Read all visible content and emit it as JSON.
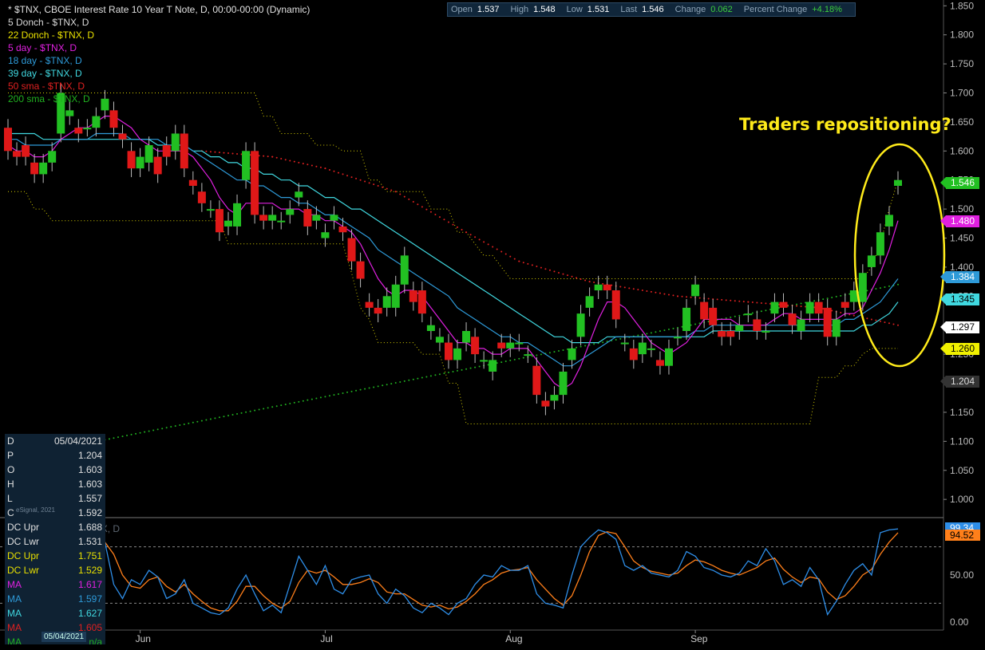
{
  "chart_data": {
    "type": "candlestick",
    "title": "* $TNX, CBOE Interest Rate 10 Year T Note, D, 00:00-00:00 (Dynamic)",
    "legend": [
      {
        "label": "5 Donch - $TNX, D",
        "color": "#d8d8d8"
      },
      {
        "label": "22 Donch - $TNX, D",
        "color": "#e8e000"
      },
      {
        "label": "5 day - $TNX, D",
        "color": "#e020e0"
      },
      {
        "label": "18 day - $TNX, D",
        "color": "#2e9ad8"
      },
      {
        "label": "39 day - $TNX, D",
        "color": "#40d8e0"
      },
      {
        "label": "50 sma - $TNX, D",
        "color": "#e02020"
      },
      {
        "label": "200 sma - $TNX, D",
        "color": "#20b020"
      }
    ],
    "quote": [
      {
        "label": "Open",
        "value": "1.537"
      },
      {
        "label": "High",
        "value": "1.548"
      },
      {
        "label": "Low",
        "value": "1.531"
      },
      {
        "label": "Last",
        "value": "1.546"
      },
      {
        "label": "Change",
        "value": "0.062"
      },
      {
        "label": "Percent Change",
        "value": "+4.18%"
      }
    ],
    "annotation": "Traders repositioning?",
    "y_axis": {
      "min": 0.97,
      "max": 1.86,
      "ticks": [
        "1.850",
        "1.800",
        "1.750",
        "1.700",
        "1.650",
        "1.600",
        "1.550",
        "1.500",
        "1.450",
        "1.400",
        "1.350",
        "1.300",
        "1.250",
        "1.200",
        "1.150",
        "1.100",
        "1.050",
        "1.000"
      ]
    },
    "x_axis": {
      "labels": [
        {
          "label": "Jun",
          "index": 15
        },
        {
          "label": "Jul",
          "index": 36
        },
        {
          "label": "Aug",
          "index": 57
        },
        {
          "label": "Sep",
          "index": 78
        }
      ]
    },
    "price_tags": [
      {
        "value": "1.546",
        "bg": "#22c022",
        "fg": "#fff",
        "price": 1.546
      },
      {
        "value": "1.480",
        "bg": "#e020e0",
        "fg": "#fff",
        "price": 1.48
      },
      {
        "value": "1.384",
        "bg": "#2e9ad8",
        "fg": "#fff",
        "price": 1.384
      },
      {
        "value": "1.345",
        "bg": "#40d8e0",
        "fg": "#000",
        "price": 1.345
      },
      {
        "value": "1.297",
        "bg": "#ffffff",
        "fg": "#000",
        "price": 1.297
      },
      {
        "value": "1.260",
        "bg": "#f0f000",
        "fg": "#000",
        "price": 1.26
      },
      {
        "value": "1.204",
        "bg": "#333333",
        "fg": "#ddd",
        "price": 1.204
      }
    ],
    "candles": [
      [
        1.64,
        1.6
      ],
      [
        1.6,
        1.59
      ],
      [
        1.61,
        1.59
      ],
      [
        1.58,
        1.56
      ],
      [
        1.56,
        1.58
      ],
      [
        1.58,
        1.6
      ],
      [
        1.63,
        1.7
      ],
      [
        1.66,
        1.67
      ],
      [
        1.64,
        1.63
      ],
      [
        1.64,
        1.64
      ],
      [
        1.64,
        1.66
      ],
      [
        1.67,
        1.69
      ],
      [
        1.67,
        1.64
      ],
      [
        1.63,
        1.62
      ],
      [
        1.6,
        1.57
      ],
      [
        1.57,
        1.59
      ],
      [
        1.58,
        1.61
      ],
      [
        1.59,
        1.56
      ],
      [
        1.61,
        1.59
      ],
      [
        1.6,
        1.63
      ],
      [
        1.63,
        1.57
      ],
      [
        1.55,
        1.54
      ],
      [
        1.53,
        1.51
      ],
      [
        1.5,
        1.5
      ],
      [
        1.5,
        1.46
      ],
      [
        1.47,
        1.48
      ],
      [
        1.47,
        1.51
      ],
      [
        1.55,
        1.6
      ],
      [
        1.6,
        1.49
      ],
      [
        1.49,
        1.48
      ],
      [
        1.48,
        1.49
      ],
      [
        1.48,
        1.48
      ],
      [
        1.49,
        1.5
      ],
      [
        1.52,
        1.53
      ],
      [
        1.5,
        1.47
      ],
      [
        1.48,
        1.49
      ],
      [
        1.45,
        1.46
      ],
      [
        1.48,
        1.49
      ],
      [
        1.47,
        1.46
      ],
      [
        1.45,
        1.41
      ],
      [
        1.41,
        1.38
      ],
      [
        1.34,
        1.33
      ],
      [
        1.33,
        1.32
      ],
      [
        1.33,
        1.35
      ],
      [
        1.33,
        1.37
      ],
      [
        1.37,
        1.42
      ],
      [
        1.36,
        1.34
      ],
      [
        1.36,
        1.32
      ],
      [
        1.29,
        1.3
      ],
      [
        1.27,
        1.28
      ],
      [
        1.27,
        1.24
      ],
      [
        1.24,
        1.26
      ],
      [
        1.27,
        1.29
      ],
      [
        1.28,
        1.25
      ],
      [
        1.24,
        1.24
      ],
      [
        1.22,
        1.24
      ],
      [
        1.27,
        1.26
      ],
      [
        1.26,
        1.27
      ],
      [
        1.27,
        1.27
      ],
      [
        1.25,
        1.25
      ],
      [
        1.23,
        1.18
      ],
      [
        1.17,
        1.16
      ],
      [
        1.17,
        1.18
      ],
      [
        1.18,
        1.22
      ],
      [
        1.24,
        1.26
      ],
      [
        1.28,
        1.32
      ],
      [
        1.33,
        1.35
      ],
      [
        1.36,
        1.37
      ],
      [
        1.37,
        1.36
      ],
      [
        1.36,
        1.31
      ],
      [
        1.27,
        1.27
      ],
      [
        1.26,
        1.24
      ],
      [
        1.25,
        1.27
      ],
      [
        1.26,
        1.26
      ],
      [
        1.24,
        1.23
      ],
      [
        1.23,
        1.26
      ],
      [
        1.28,
        1.28
      ],
      [
        1.29,
        1.33
      ],
      [
        1.35,
        1.37
      ],
      [
        1.34,
        1.31
      ],
      [
        1.33,
        1.3
      ],
      [
        1.29,
        1.28
      ],
      [
        1.29,
        1.28
      ],
      [
        1.29,
        1.3
      ],
      [
        1.32,
        1.32
      ],
      [
        1.31,
        1.29
      ],
      [
        1.29,
        1.29
      ],
      [
        1.32,
        1.34
      ],
      [
        1.34,
        1.33
      ],
      [
        1.32,
        1.3
      ],
      [
        1.29,
        1.31
      ],
      [
        1.32,
        1.34
      ],
      [
        1.34,
        1.32
      ],
      [
        1.33,
        1.28
      ],
      [
        1.28,
        1.31
      ],
      [
        1.34,
        1.33
      ],
      [
        1.34,
        1.36
      ],
      [
        1.34,
        1.39
      ],
      [
        1.4,
        1.42
      ],
      [
        1.42,
        1.46
      ],
      [
        1.47,
        1.49
      ],
      [
        1.54,
        1.55
      ]
    ],
    "stochastic": {
      "title": "Stochastic - $TNX, D",
      "y_ticks": [
        "50.00",
        "0.00"
      ],
      "overbought": 80,
      "oversold": 20,
      "k_value": "99.34",
      "d_value": "94.52",
      "k": [
        55,
        40,
        25,
        15,
        45,
        80,
        98,
        78,
        60,
        85,
        88,
        85,
        40,
        25,
        45,
        40,
        55,
        48,
        25,
        30,
        45,
        20,
        15,
        10,
        8,
        15,
        35,
        50,
        30,
        12,
        18,
        10,
        40,
        70,
        55,
        40,
        60,
        35,
        30,
        45,
        48,
        50,
        30,
        20,
        35,
        28,
        15,
        10,
        20,
        15,
        8,
        20,
        25,
        40,
        50,
        48,
        60,
        55,
        55,
        60,
        30,
        20,
        18,
        15,
        50,
        80,
        90,
        98,
        95,
        88,
        60,
        55,
        60,
        52,
        50,
        48,
        55,
        75,
        70,
        58,
        55,
        50,
        48,
        52,
        65,
        60,
        78,
        65,
        40,
        45,
        38,
        58,
        45,
        8,
        22,
        40,
        55,
        62,
        50,
        95,
        98,
        99
      ],
      "d": [
        65,
        52,
        35,
        28,
        32,
        50,
        72,
        85,
        80,
        78,
        80,
        85,
        72,
        50,
        38,
        36,
        45,
        48,
        38,
        32,
        40,
        30,
        22,
        15,
        12,
        12,
        22,
        38,
        38,
        28,
        20,
        15,
        22,
        42,
        55,
        52,
        55,
        48,
        40,
        40,
        42,
        46,
        42,
        32,
        30,
        30,
        24,
        18,
        16,
        18,
        14,
        16,
        22,
        30,
        40,
        45,
        52,
        55,
        56,
        58,
        45,
        35,
        25,
        18,
        28,
        50,
        75,
        92,
        96,
        94,
        80,
        65,
        58,
        54,
        52,
        50,
        52,
        60,
        66,
        64,
        60,
        55,
        52,
        50,
        54,
        58,
        65,
        68,
        56,
        48,
        42,
        48,
        46,
        32,
        24,
        28,
        38,
        50,
        56,
        72,
        85,
        95
      ]
    },
    "ma_lines": {
      "ma5": [
        1.61,
        1.6,
        1.6,
        1.59,
        1.59,
        1.6,
        1.62,
        1.63,
        1.64,
        1.64,
        1.65,
        1.66,
        1.66,
        1.65,
        1.64,
        1.62,
        1.61,
        1.6,
        1.6,
        1.6,
        1.6,
        1.59,
        1.57,
        1.55,
        1.52,
        1.5,
        1.49,
        1.51,
        1.51,
        1.51,
        1.51,
        1.5,
        1.5,
        1.5,
        1.49,
        1.49,
        1.48,
        1.48,
        1.47,
        1.46,
        1.44,
        1.41,
        1.38,
        1.36,
        1.35,
        1.36,
        1.36,
        1.35,
        1.33,
        1.31,
        1.29,
        1.27,
        1.27,
        1.26,
        1.26,
        1.25,
        1.25,
        1.26,
        1.26,
        1.26,
        1.24,
        1.22,
        1.2,
        1.19,
        1.2,
        1.23,
        1.27,
        1.31,
        1.34,
        1.34,
        1.33,
        1.31,
        1.29,
        1.27,
        1.26,
        1.25,
        1.26,
        1.27,
        1.29,
        1.31,
        1.31,
        1.31,
        1.31,
        1.3,
        1.3,
        1.3,
        1.3,
        1.31,
        1.32,
        1.32,
        1.31,
        1.31,
        1.31,
        1.31,
        1.31,
        1.32,
        1.32,
        1.33,
        1.36,
        1.39,
        1.43,
        1.48
      ],
      "ma18": [
        1.62,
        1.62,
        1.61,
        1.61,
        1.61,
        1.61,
        1.62,
        1.62,
        1.62,
        1.62,
        1.63,
        1.63,
        1.63,
        1.63,
        1.62,
        1.62,
        1.62,
        1.62,
        1.61,
        1.61,
        1.61,
        1.6,
        1.59,
        1.58,
        1.57,
        1.56,
        1.55,
        1.55,
        1.54,
        1.54,
        1.53,
        1.52,
        1.52,
        1.51,
        1.51,
        1.5,
        1.49,
        1.49,
        1.48,
        1.47,
        1.46,
        1.45,
        1.43,
        1.42,
        1.41,
        1.4,
        1.39,
        1.38,
        1.37,
        1.36,
        1.35,
        1.33,
        1.32,
        1.31,
        1.3,
        1.29,
        1.28,
        1.28,
        1.27,
        1.27,
        1.26,
        1.25,
        1.24,
        1.23,
        1.23,
        1.24,
        1.25,
        1.26,
        1.27,
        1.28,
        1.28,
        1.28,
        1.28,
        1.28,
        1.28,
        1.28,
        1.28,
        1.28,
        1.29,
        1.29,
        1.3,
        1.3,
        1.3,
        1.3,
        1.3,
        1.3,
        1.3,
        1.3,
        1.3,
        1.3,
        1.3,
        1.3,
        1.3,
        1.3,
        1.3,
        1.31,
        1.31,
        1.32,
        1.33,
        1.34,
        1.36,
        1.38
      ],
      "ma39": [
        1.63,
        1.63,
        1.63,
        1.63,
        1.62,
        1.62,
        1.62,
        1.62,
        1.62,
        1.62,
        1.62,
        1.62,
        1.62,
        1.62,
        1.62,
        1.62,
        1.62,
        1.61,
        1.61,
        1.61,
        1.61,
        1.6,
        1.6,
        1.59,
        1.59,
        1.58,
        1.58,
        1.57,
        1.57,
        1.56,
        1.56,
        1.55,
        1.55,
        1.54,
        1.54,
        1.53,
        1.52,
        1.52,
        1.51,
        1.5,
        1.5,
        1.49,
        1.48,
        1.47,
        1.46,
        1.45,
        1.44,
        1.43,
        1.42,
        1.41,
        1.4,
        1.39,
        1.38,
        1.37,
        1.36,
        1.35,
        1.34,
        1.33,
        1.32,
        1.31,
        1.3,
        1.29,
        1.28,
        1.28,
        1.27,
        1.27,
        1.27,
        1.27,
        1.28,
        1.28,
        1.28,
        1.28,
        1.28,
        1.28,
        1.28,
        1.28,
        1.28,
        1.28,
        1.28,
        1.28,
        1.29,
        1.29,
        1.29,
        1.29,
        1.29,
        1.29,
        1.29,
        1.29,
        1.29,
        1.29,
        1.29,
        1.29,
        1.29,
        1.29,
        1.29,
        1.29,
        1.29,
        1.3,
        1.3,
        1.31,
        1.32,
        1.34
      ],
      "sma50_start": [
        22,
        1.6
      ],
      "sma50_end": [
        101,
        1.3
      ],
      "sma200_start": [
        0,
        1.07
      ],
      "sma200_end": [
        101,
        1.37
      ],
      "donch22_upper": [
        1.7,
        1.7,
        1.7,
        1.7,
        1.7,
        1.7,
        1.7,
        1.7,
        1.7,
        1.7,
        1.7,
        1.7,
        1.7,
        1.7,
        1.7,
        1.7,
        1.7,
        1.7,
        1.7,
        1.7,
        1.7,
        1.7,
        1.7,
        1.7,
        1.7,
        1.7,
        1.7,
        1.7,
        1.7,
        1.66,
        1.66,
        1.63,
        1.63,
        1.63,
        1.63,
        1.61,
        1.61,
        1.61,
        1.6,
        1.6,
        1.6,
        1.55,
        1.55,
        1.53,
        1.53,
        1.53,
        1.53,
        1.53,
        1.5,
        1.5,
        1.5,
        1.46,
        1.46,
        1.44,
        1.42,
        1.42,
        1.4,
        1.38,
        1.38,
        1.38,
        1.38,
        1.38,
        1.38,
        1.38,
        1.38,
        1.38,
        1.38,
        1.38,
        1.38,
        1.38,
        1.38,
        1.38,
        1.38,
        1.38,
        1.38,
        1.38,
        1.38,
        1.38,
        1.38,
        1.38,
        1.38,
        1.38,
        1.38,
        1.38,
        1.38,
        1.38,
        1.38,
        1.38,
        1.38,
        1.38,
        1.38,
        1.38,
        1.38,
        1.38,
        1.38,
        1.38,
        1.38,
        1.38,
        1.4,
        1.44,
        1.5,
        1.55
      ],
      "donch22_lower": [
        1.53,
        1.53,
        1.53,
        1.5,
        1.5,
        1.48,
        1.48,
        1.48,
        1.48,
        1.48,
        1.48,
        1.48,
        1.48,
        1.48,
        1.48,
        1.48,
        1.48,
        1.48,
        1.48,
        1.48,
        1.48,
        1.48,
        1.48,
        1.48,
        1.48,
        1.44,
        1.44,
        1.44,
        1.44,
        1.44,
        1.44,
        1.44,
        1.44,
        1.44,
        1.44,
        1.44,
        1.44,
        1.44,
        1.44,
        1.39,
        1.33,
        1.31,
        1.27,
        1.27,
        1.27,
        1.27,
        1.27,
        1.25,
        1.25,
        1.25,
        1.2,
        1.2,
        1.13,
        1.13,
        1.13,
        1.13,
        1.13,
        1.13,
        1.13,
        1.13,
        1.13,
        1.13,
        1.13,
        1.13,
        1.13,
        1.13,
        1.13,
        1.13,
        1.13,
        1.13,
        1.13,
        1.13,
        1.13,
        1.13,
        1.13,
        1.13,
        1.13,
        1.13,
        1.13,
        1.13,
        1.13,
        1.13,
        1.13,
        1.13,
        1.13,
        1.13,
        1.13,
        1.13,
        1.13,
        1.13,
        1.13,
        1.13,
        1.21,
        1.21,
        1.21,
        1.23,
        1.23,
        1.25,
        1.26,
        1.26,
        1.26,
        1.26
      ]
    }
  },
  "data_window": {
    "rows": [
      {
        "label": "D",
        "value": "05/04/2021",
        "color": "#e0e0e0"
      },
      {
        "label": "P",
        "value": "1.204",
        "color": "#e0e0e0"
      },
      {
        "label": "O",
        "value": "1.603",
        "color": "#e0e0e0"
      },
      {
        "label": "H",
        "value": "1.603",
        "color": "#e0e0e0"
      },
      {
        "label": "L",
        "value": "1.557",
        "color": "#e0e0e0"
      },
      {
        "label": "C",
        "value": "1.592",
        "color": "#e0e0e0"
      },
      {
        "label": "DC Upr",
        "value": "1.688",
        "color": "#e0e0e0"
      },
      {
        "label": "DC Lwr",
        "value": "1.531",
        "color": "#e0e0e0"
      },
      {
        "label": "DC Upr",
        "value": "1.751",
        "color": "#e8e000"
      },
      {
        "label": "DC Lwr",
        "value": "1.529",
        "color": "#e8e000"
      },
      {
        "label": "MA",
        "value": "1.617",
        "color": "#e020e0"
      },
      {
        "label": "MA",
        "value": "1.597",
        "color": "#2e9ad8"
      },
      {
        "label": "MA",
        "value": "1.627",
        "color": "#40d8e0"
      },
      {
        "label": "MA",
        "value": "1.605",
        "color": "#e02020"
      },
      {
        "label": "MA",
        "value": "n/a",
        "color": "#20b020"
      }
    ],
    "watermark": "eSignal, 2021",
    "date_box": "05/04/2021"
  }
}
